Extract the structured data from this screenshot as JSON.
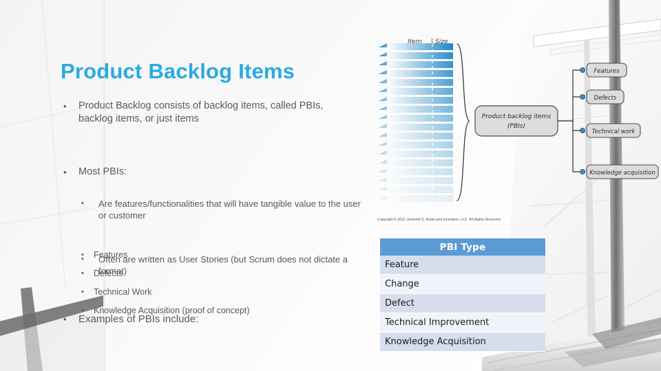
{
  "slide": {
    "title": "Product Backlog Items",
    "title_color": "#29ABE2",
    "body_color": "#595959",
    "bullet_glyph": "•"
  },
  "body": {
    "bullets": [
      {
        "level": 1,
        "text": "Product Backlog consists of backlog items, called PBIs, backlog items, or just items"
      },
      {
        "level": 1,
        "text": "Most PBIs:"
      },
      {
        "level": 2,
        "text": " Are features/functionalities that will have tangible value to the user or customer"
      },
      {
        "level": 2,
        "text": "Often are written as User Stories (but Scrum does not dictate a format)"
      },
      {
        "level": 1,
        "text": "Examples of PBIs include:"
      }
    ],
    "examples": [
      "Features",
      "Defects",
      "Technical Work",
      "Knowledge Acquisition (proof of concept)"
    ]
  },
  "diagram": {
    "column_header_item": "Item",
    "column_header_size": "Size",
    "header_divider": "|",
    "center_node_line1": "Product backlog items",
    "center_node_line2": "(PBIs)",
    "branches": [
      "Features",
      "Defects",
      "Technical work",
      "Knowledge acquisition"
    ],
    "copyright": "Copyright © 2012, Kenneth S. Rubin and Innolution, LLC. All Rights Reserved",
    "stack_top_color": "#1E87C8",
    "stack_bottom_color": "#F3F7FC",
    "node_fill": "#DCDCDC",
    "node_stroke": "#4D4D4D",
    "connector_dot_color": "#3C8DC5"
  },
  "pbi_table": {
    "header": "PBI Type",
    "header_bg": "#5B9BD5",
    "row_odd_bg": "#D6DEEE",
    "row_even_bg": "#F0F3FA",
    "rows": [
      "Feature",
      "Change",
      "Defect",
      "Technical Improvement",
      "Knowledge Acquisition"
    ]
  }
}
